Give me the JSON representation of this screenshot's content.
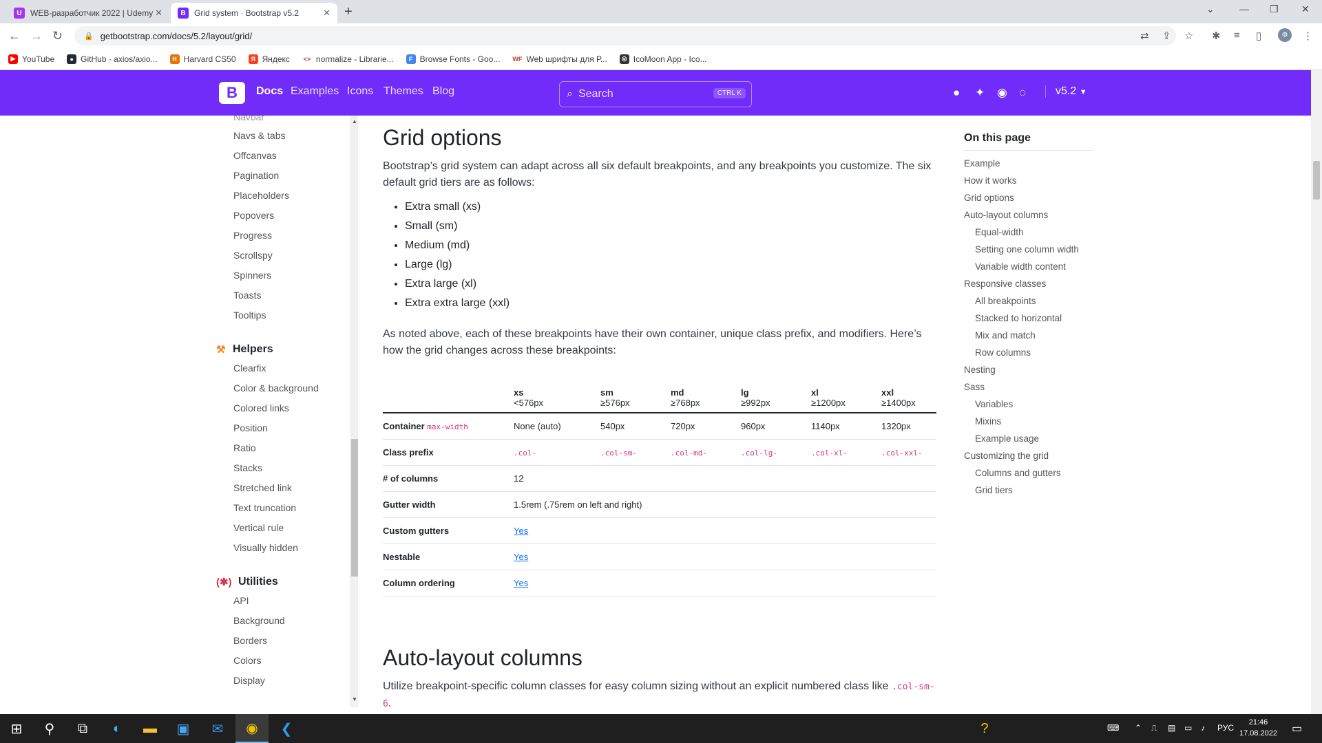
{
  "browser": {
    "tabs": [
      {
        "title": "WEB-разработчик 2022 | Udemy",
        "favicon": "udemy-icon",
        "active": false
      },
      {
        "title": "Grid system · Bootstrap v5.2",
        "favicon": "bootstrap-icon",
        "active": true
      }
    ],
    "url": "getbootstrap.com/docs/5.2/layout/grid/",
    "bookmarks": [
      {
        "label": "YouTube",
        "color": "#ff0000",
        "glyph": "▶"
      },
      {
        "label": "GitHub - axios/axio...",
        "color": "#24292f",
        "glyph": "●"
      },
      {
        "label": "Harvard CS50",
        "color": "#e8710a",
        "glyph": "H"
      },
      {
        "label": "Яндекс",
        "color": "#fc3f1d",
        "glyph": "Я"
      },
      {
        "label": "normalize - Librarie...",
        "color": "#ffffff",
        "glyph": "<>"
      },
      {
        "label": "Browse Fonts - Goo...",
        "color": "#4285f4",
        "glyph": "F"
      },
      {
        "label": "Web шрифты для Р...",
        "color": "#ffffff",
        "glyph": "WF"
      },
      {
        "label": "IcoMoon App - Ico...",
        "color": "#333333",
        "glyph": "◎"
      }
    ]
  },
  "bsnav": {
    "links": [
      "Docs",
      "Examples",
      "Icons",
      "Themes",
      "Blog"
    ],
    "search_placeholder": "Search",
    "search_kbd": "CTRL K",
    "version": "v5.2",
    "accent": "#712cf9"
  },
  "sidebar": {
    "partial_item": "Navbar",
    "components": [
      "Navs & tabs",
      "Offcanvas",
      "Pagination",
      "Placeholders",
      "Popovers",
      "Progress",
      "Scrollspy",
      "Spinners",
      "Toasts",
      "Tooltips"
    ],
    "helpers_title": "Helpers",
    "helpers": [
      "Clearfix",
      "Color & background",
      "Colored links",
      "Position",
      "Ratio",
      "Stacks",
      "Stretched link",
      "Text truncation",
      "Vertical rule",
      "Visually hidden"
    ],
    "utilities_title": "Utilities",
    "utilities": [
      "API",
      "Background",
      "Borders",
      "Colors",
      "Display"
    ]
  },
  "main": {
    "grid_title": "Grid options",
    "intro": "Bootstrap’s grid system can adapt across all six default breakpoints, and any breakpoints you customize. The six default grid tiers are as follows:",
    "tiers": [
      "Extra small (xs)",
      "Small (sm)",
      "Medium (md)",
      "Large (lg)",
      "Extra large (xl)",
      "Extra extra large (xxl)"
    ],
    "noted": "As noted above, each of these breakpoints have their own container, unique class prefix, and modifiers. Here’s how the grid changes across these breakpoints:",
    "table": {
      "breakpoints": [
        {
          "name": "xs",
          "size": "<576px"
        },
        {
          "name": "sm",
          "size": "≥576px"
        },
        {
          "name": "md",
          "size": "≥768px"
        },
        {
          "name": "lg",
          "size": "≥992px"
        },
        {
          "name": "xl",
          "size": "≥1200px"
        },
        {
          "name": "xxl",
          "size": "≥1400px"
        }
      ],
      "container_label": "Container",
      "container_code": "max-width",
      "container_values": [
        "None (auto)",
        "540px",
        "720px",
        "960px",
        "1140px",
        "1320px"
      ],
      "prefix_label": "Class prefix",
      "prefix_values": [
        ".col-",
        ".col-sm-",
        ".col-md-",
        ".col-lg-",
        ".col-xl-",
        ".col-xxl-"
      ],
      "columns_label": "# of columns",
      "columns_value": "12",
      "gutter_label": "Gutter width",
      "gutter_value": "1.5rem (.75rem on left and right)",
      "custom_label": "Custom gutters",
      "custom_value": "Yes",
      "nestable_label": "Nestable",
      "nestable_value": "Yes",
      "ordering_label": "Column ordering",
      "ordering_value": "Yes"
    },
    "auto_title": "Auto-layout columns",
    "auto_intro": "Utilize breakpoint-specific column classes for easy column sizing without an explicit numbered class like",
    "auto_code": ".col-sm-6",
    "auto_end": "."
  },
  "toc": {
    "title": "On this page",
    "items": [
      {
        "label": "Example",
        "level": 0
      },
      {
        "label": "How it works",
        "level": 0
      },
      {
        "label": "Grid options",
        "level": 0
      },
      {
        "label": "Auto-layout columns",
        "level": 0
      },
      {
        "label": "Equal-width",
        "level": 1
      },
      {
        "label": "Setting one column width",
        "level": 1
      },
      {
        "label": "Variable width content",
        "level": 1
      },
      {
        "label": "Responsive classes",
        "level": 0
      },
      {
        "label": "All breakpoints",
        "level": 1
      },
      {
        "label": "Stacked to horizontal",
        "level": 1
      },
      {
        "label": "Mix and match",
        "level": 1
      },
      {
        "label": "Row columns",
        "level": 1
      },
      {
        "label": "Nesting",
        "level": 0
      },
      {
        "label": "Sass",
        "level": 0
      },
      {
        "label": "Variables",
        "level": 1
      },
      {
        "label": "Mixins",
        "level": 1
      },
      {
        "label": "Example usage",
        "level": 1
      },
      {
        "label": "Customizing the grid",
        "level": 0
      },
      {
        "label": "Columns and gutters",
        "level": 1
      },
      {
        "label": "Grid tiers",
        "level": 1
      }
    ]
  },
  "taskbar": {
    "lang": "РУС",
    "time": "21:46",
    "date": "17.08.2022"
  }
}
